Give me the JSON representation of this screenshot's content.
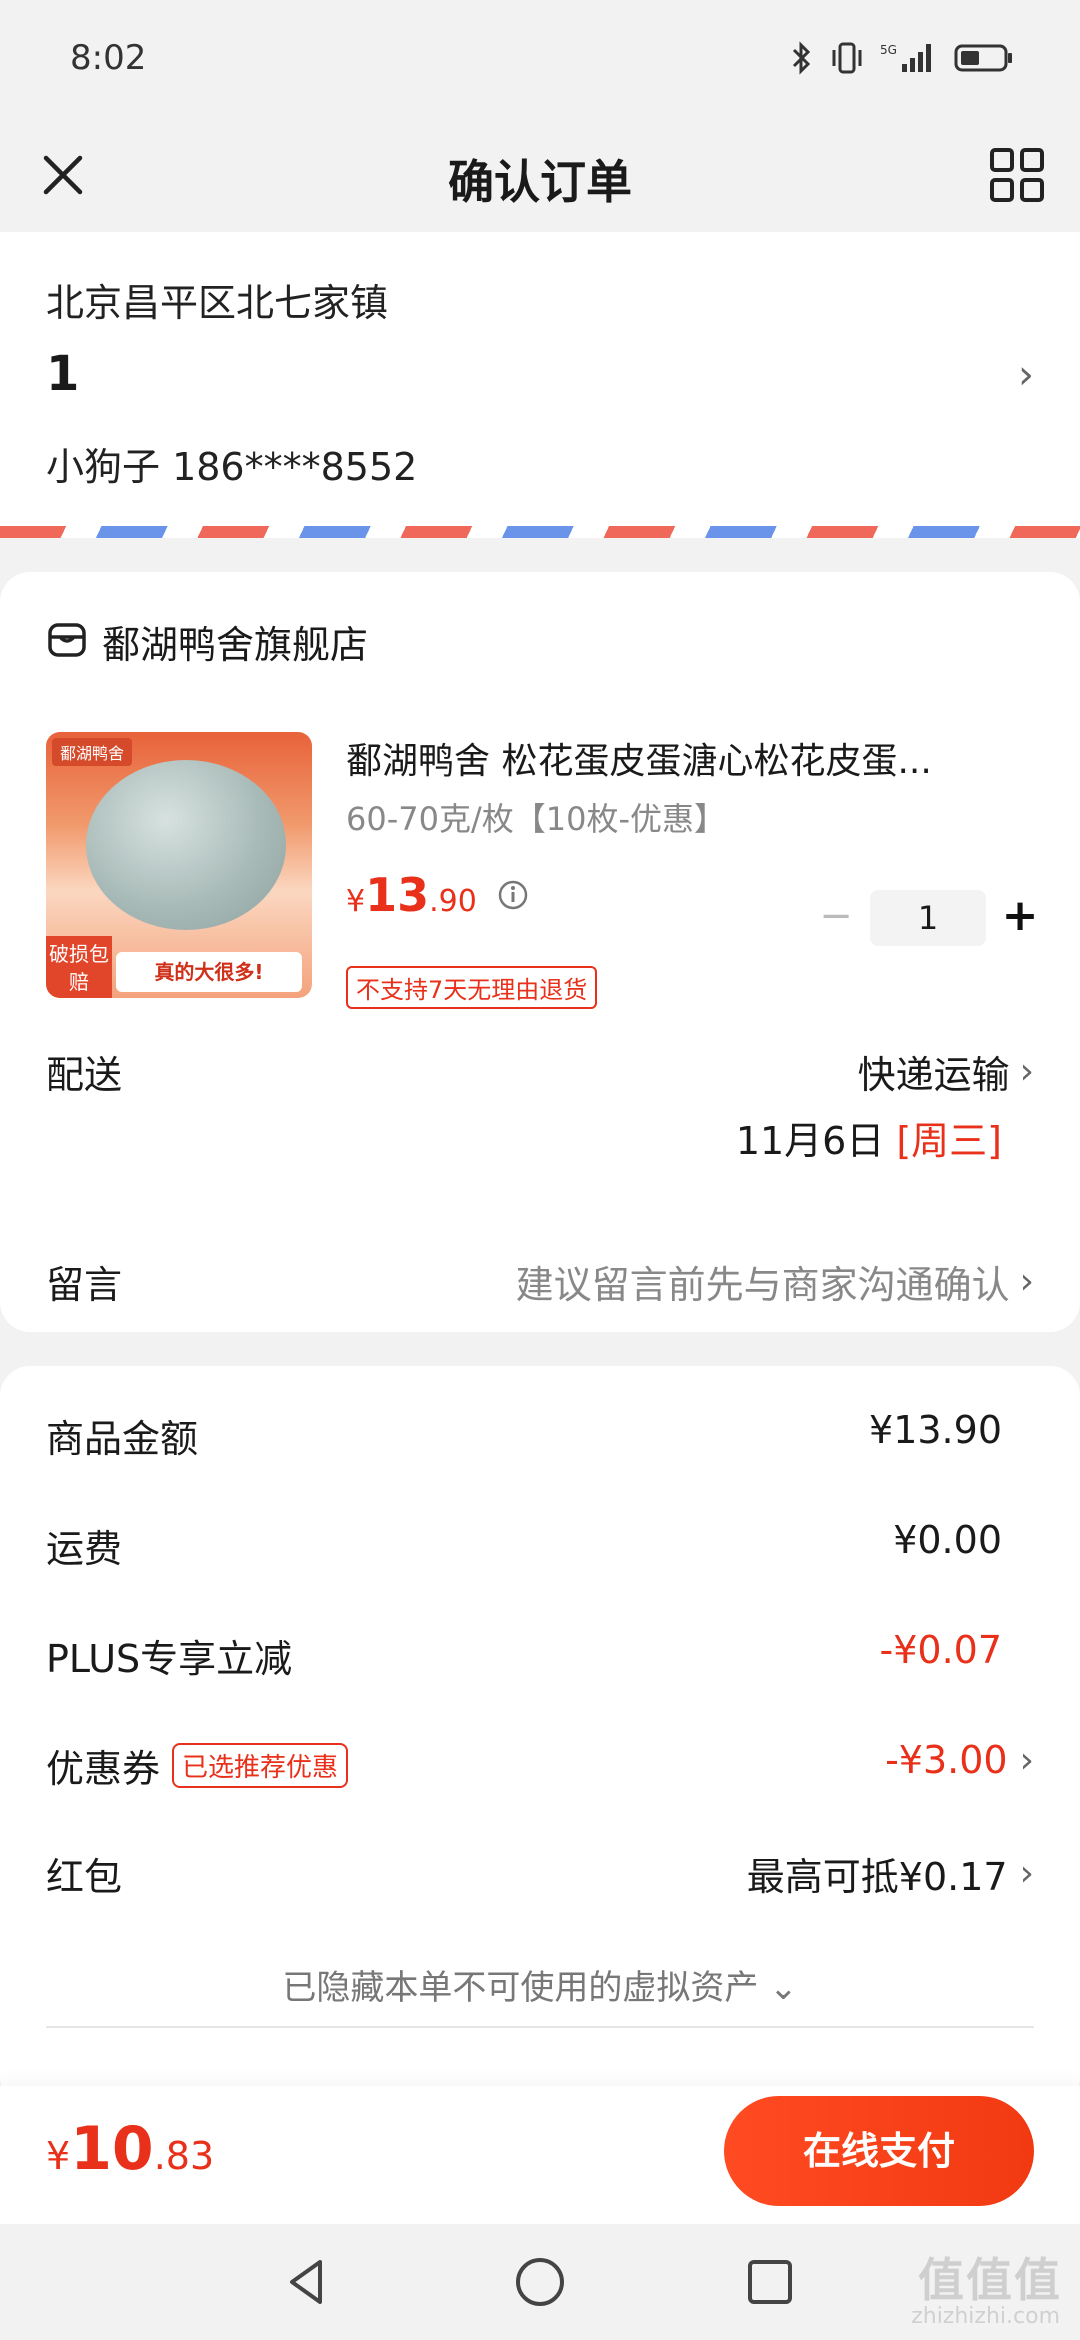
{
  "status_bar": {
    "time": "8:02",
    "signal": "5G"
  },
  "nav": {
    "title": "确认订单"
  },
  "address": {
    "region": "北京昌平区北七家镇",
    "detail": "1",
    "contact": "小狗子 186****8552"
  },
  "store": {
    "name": "鄱湖鸭舍旗舰店",
    "product": {
      "title": "鄱湖鸭舍 松花蛋皮蛋溏心松花皮蛋...",
      "spec": "60-70克/枚【10枚-优惠】",
      "price_symbol": "¥",
      "price_int": "13",
      "price_dec": ".90",
      "quantity": "1",
      "return_policy": "不支持7天无理由退货",
      "image_tags": {
        "top": "鄱湖鸭舍",
        "left": "破损包赔",
        "bottom": "真的大很多!"
      }
    },
    "delivery": {
      "label": "配送",
      "method": "快递运输",
      "date": "11月6日",
      "weekday": "[周三]"
    },
    "message": {
      "label": "留言",
      "placeholder": "建议留言前先与商家沟通确认"
    }
  },
  "summary": {
    "rows": [
      {
        "label": "商品金额",
        "value": "¥13.90"
      },
      {
        "label": "运费",
        "value": "¥0.00"
      },
      {
        "label": "PLUS专享立减",
        "value": "-¥0.07"
      },
      {
        "label": "优惠券",
        "badge": "已选推荐优惠",
        "value": "-¥3.00"
      },
      {
        "label": "红包",
        "value": "最高可抵¥0.17"
      }
    ],
    "hidden_assets": "已隐藏本单不可使用的虚拟资产"
  },
  "footer": {
    "total_symbol": "¥",
    "total_int": "10",
    "total_dec": ".83",
    "pay_label": "在线支付"
  },
  "watermark": {
    "text": "值值值",
    "sub": "zhizhizhi.com"
  },
  "colors": {
    "accent": "#e8301a",
    "background": "#f2f2f2",
    "card": "#ffffff"
  }
}
